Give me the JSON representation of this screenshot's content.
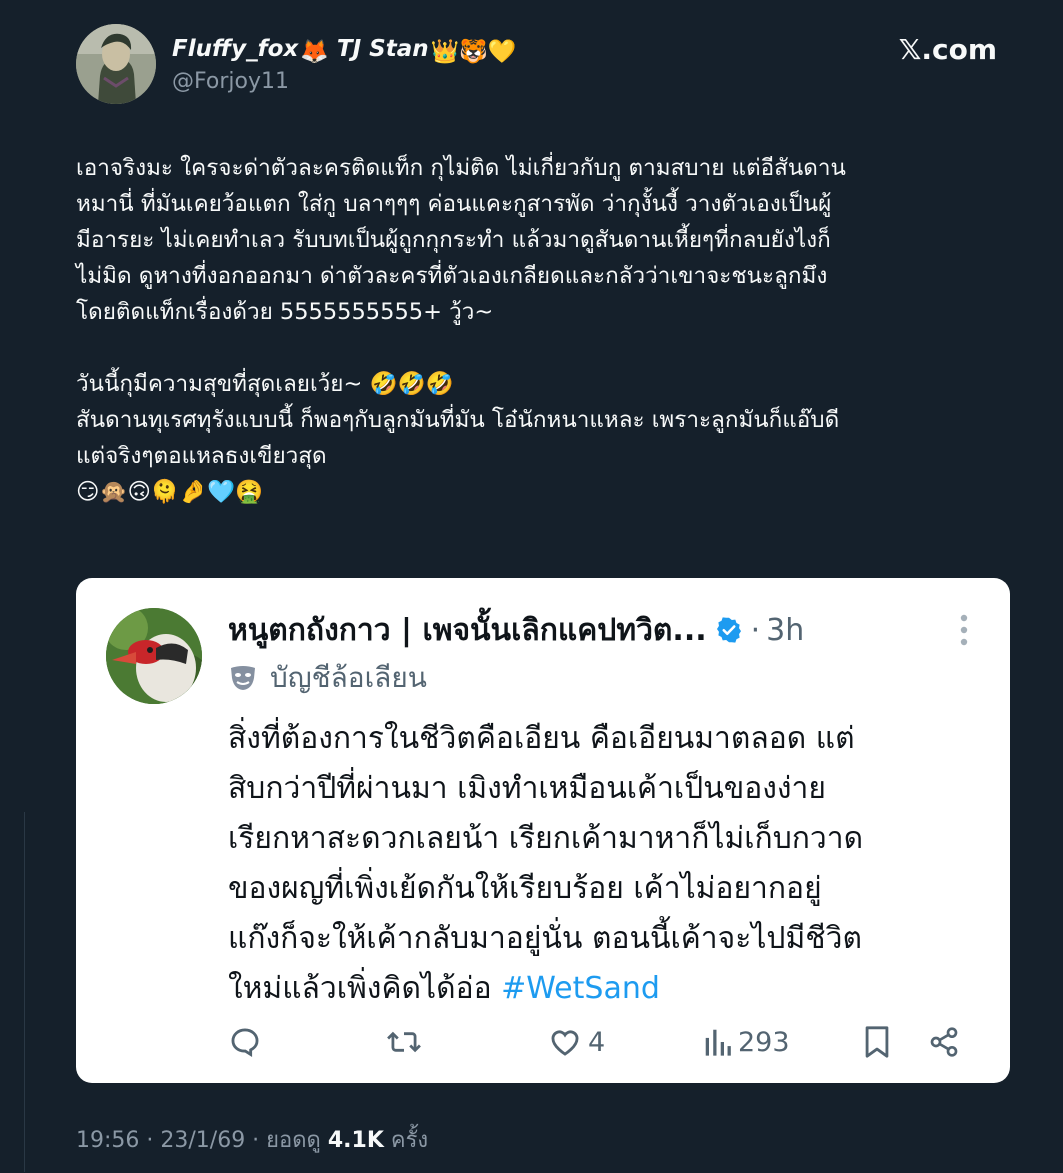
{
  "author": {
    "display_name": "Fluffy_fox",
    "name_suffix": "TJ Stan",
    "name_emojis_a": "🦊",
    "name_emojis_b": "👑🐯💛",
    "handle": "@Forjoy11"
  },
  "brand": {
    "label": ".com",
    "x_glyph": "𝕏"
  },
  "tweet": {
    "lines": [
      "เอาจริงมะ ใครจะด่าตัวละครติดแท็ก กุไม่ติด ไม่เกี่ยวกับกู ตามสบาย แต่อีสันดาน",
      "หมานี่ ที่มันเคยว้อแตก ใส่กู บลาๆๆๆ ค่อนแคะกูสารพัด ว่ากุงั้นงี้  วางตัวเองเป็นผู้",
      "มีอารยะ ไม่เคยทำเลว รับบทเป็นผู้ถูกกุกระทำ แล้วมาดูสันดานเหี้ยๆที่กลบยังไงก็",
      "ไม่มิด ดูหางที่งอกออกมา ด่าตัวละครที่ตัวเองเกลียดและกลัวว่าเขาจะชนะลูกมึง",
      "โดยติดแท็กเรื่องด้วย 5555555555+ วู้ว~"
    ],
    "lines2": [
      "วันนี้กุมีความสุขที่สุดเลยเว้ย~ 🤣🤣🤣",
      "สันดานทุเรศทุรังแบบนี้ ก็พอๆกับลูกมันที่มัน โอ๋นักหนาแหละ เพราะลูกมันก็แอ๊บดี",
      "แต่จริงๆตอแหลธงเขียวสุด",
      " 😏🙊🙃🫠🤌🩵🤮"
    ]
  },
  "quote": {
    "name": "หนูตกถังกาว | เพจนั้นเลิกแคปทวิต...",
    "dot": "·",
    "time": "3h",
    "label": "บัญชีล้อเลียน",
    "lines": [
      "สิ่งที่ต้องการในชีวิตคือเอียน คือเอียนมาตลอด แต่",
      "สิบกว่าปีที่ผ่านมา เมิงทำเหมือนเค้าเป็นของง่าย",
      "เรียกหาสะดวกเลยน้า เรียกเค้ามาหาก็ไม่เก็บกวาด",
      "ของผญที่เพิ่งเย้ดกันให้เรียบร้อย เค้าไม่อยากอยู่",
      "แก๊งก็จะให้เค้ากลับมาอยู่นั่น ตอนนี้เค้าจะไปมีชีวิต"
    ],
    "last_line_prefix": "ใหม่แล้วเพิ่งคิดได้อ่อ ",
    "hashtag": "#WetSand",
    "likes": "4",
    "views": "293"
  },
  "footer": {
    "time_date": "19:56 · 23/1/69 · ยอดดู ",
    "views": "4.1K",
    "views_suffix": " ครั้ง"
  },
  "colors": {
    "background": "#15202b",
    "card": "#ffffff",
    "link": "#1d9bf0",
    "muted": "#8b98a5",
    "verified": "#1d9bf0"
  }
}
